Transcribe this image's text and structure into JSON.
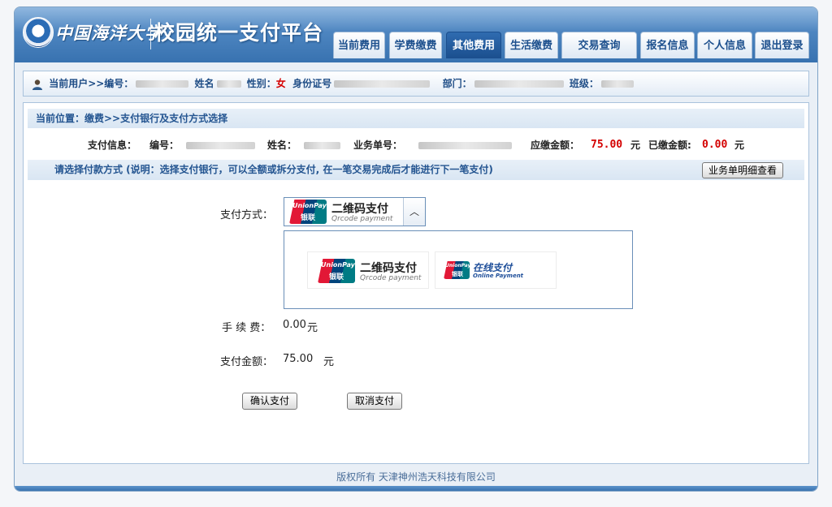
{
  "header": {
    "university_name": "中国海洋大学",
    "platform_title": "校园统一支付平台"
  },
  "nav": {
    "tabs": [
      {
        "label": "当前费用",
        "active": false
      },
      {
        "label": "学费缴费",
        "active": false
      },
      {
        "label": "其他费用",
        "active": true
      },
      {
        "label": "生活缴费",
        "active": false
      },
      {
        "label": "交易查询",
        "active": false
      },
      {
        "label": "报名信息",
        "active": false
      },
      {
        "label": "个人信息",
        "active": false
      },
      {
        "label": "退出登录",
        "active": false
      }
    ]
  },
  "userbar": {
    "current_user_label": "当前用户>>编号：",
    "name_label": "姓名",
    "gender_label": "性别：",
    "gender_value": "女",
    "id_label": "身份证号",
    "dept_label": "部门：",
    "class_label": "班级："
  },
  "breadcrumb": "当前位置：缴费>>支付银行及支付方式选择",
  "payinfo": {
    "label": "支付信息：",
    "number_label": "编号：",
    "name_label": "姓名：",
    "order_label": "业务单号：",
    "due_label": "应缴金额：",
    "due_value": "75.00",
    "due_unit": "元",
    "paid_label": "已缴金额:",
    "paid_value": "0.00",
    "paid_unit": "元"
  },
  "instruction": "请选择付款方式 (说明：选择支付银行，可以全额或拆分支付, 在一笔交易完成后才能进行下一笔支付)",
  "detail_button": "业务单明细查看",
  "payment": {
    "method_label": "支付方式：",
    "selected_title": "二维码支付",
    "selected_sub": "Qrcode payment",
    "logo_en": "UnionPay",
    "logo_cn": "银联",
    "options": [
      {
        "title": "二维码支付",
        "sub": "Qrcode payment"
      },
      {
        "title": "在线支付",
        "sub": "Online Payment"
      }
    ],
    "fee_label": "手 续 费：",
    "fee_value": "0.00",
    "fee_unit": "元",
    "amount_label": "支付金额：",
    "amount_value": "75.00",
    "amount_unit": "元"
  },
  "actions": {
    "confirm": "确认支付",
    "cancel": "取消支付"
  },
  "footer": "版权所有 天津神州浩天科技有限公司",
  "colors": {
    "header_blue": "#3872b0",
    "amount_red": "#d40000",
    "link_blue": "#245591"
  }
}
